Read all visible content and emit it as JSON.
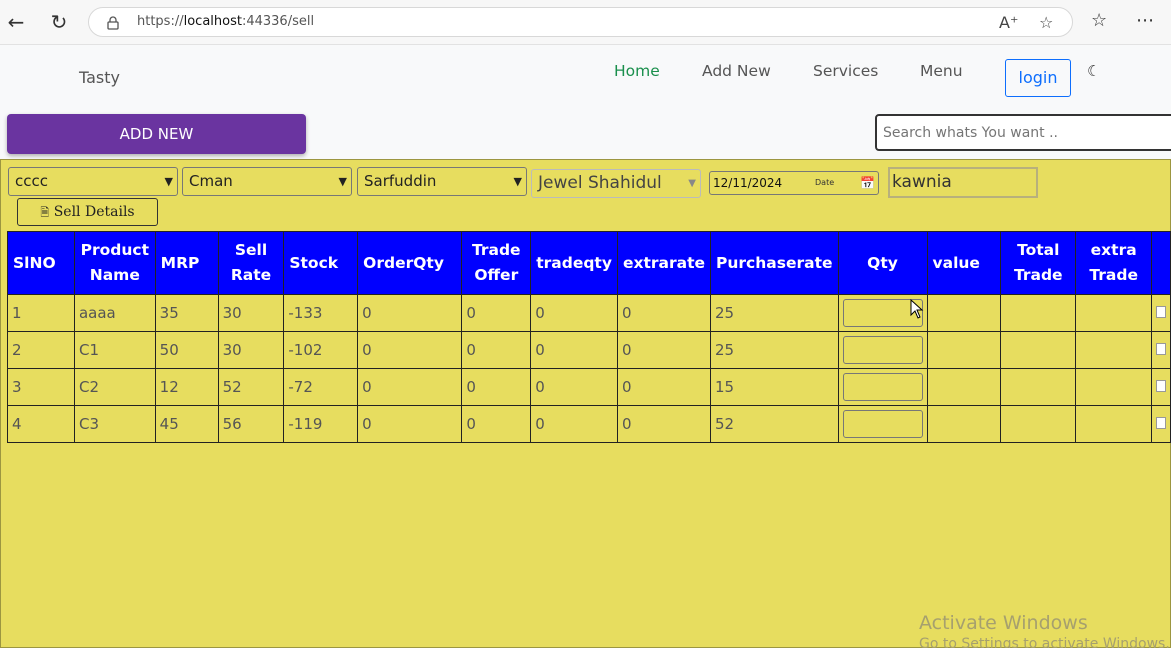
{
  "browser": {
    "url_prefix": "https://",
    "url_host": "localhost",
    "url_rest": ":44336/sell"
  },
  "nav": {
    "brand": "Tasty",
    "links": [
      "Home",
      "Add New",
      "Services",
      "Menu"
    ],
    "login": "login"
  },
  "actions": {
    "add_new": "ADD NEW",
    "search_placeholder": "Search whats You want .."
  },
  "filters": {
    "select1": "cccc",
    "select2": "Cman",
    "select3": "Sarfuddin",
    "select4": "Jewel Shahidul",
    "date": "12/11/2024",
    "date_label": "Date",
    "text_value": "kawnia",
    "sell_details": "Sell Details"
  },
  "table": {
    "headers": [
      "SlNO",
      "Product Name",
      "MRP",
      "Sell Rate",
      "Stock",
      "OrderQty",
      "Trade Offer",
      "tradeqty",
      "extrarate",
      "Purchaserate",
      "Qty",
      "value",
      "Total Trade",
      "extra Trade"
    ],
    "rows": [
      [
        "1",
        "aaaa",
        "35",
        "30",
        "-133",
        "0",
        "0",
        "0",
        "0",
        "25"
      ],
      [
        "2",
        "C1",
        "50",
        "30",
        "-102",
        "0",
        "0",
        "0",
        "0",
        "25"
      ],
      [
        "3",
        "C2",
        "12",
        "52",
        "-72",
        "0",
        "0",
        "0",
        "0",
        "15"
      ],
      [
        "4",
        "C3",
        "45",
        "56",
        "-119",
        "0",
        "0",
        "0",
        "0",
        "52"
      ]
    ]
  },
  "watermark": {
    "line1": "Activate Windows",
    "line2": "Go to Settings to activate Windows."
  }
}
